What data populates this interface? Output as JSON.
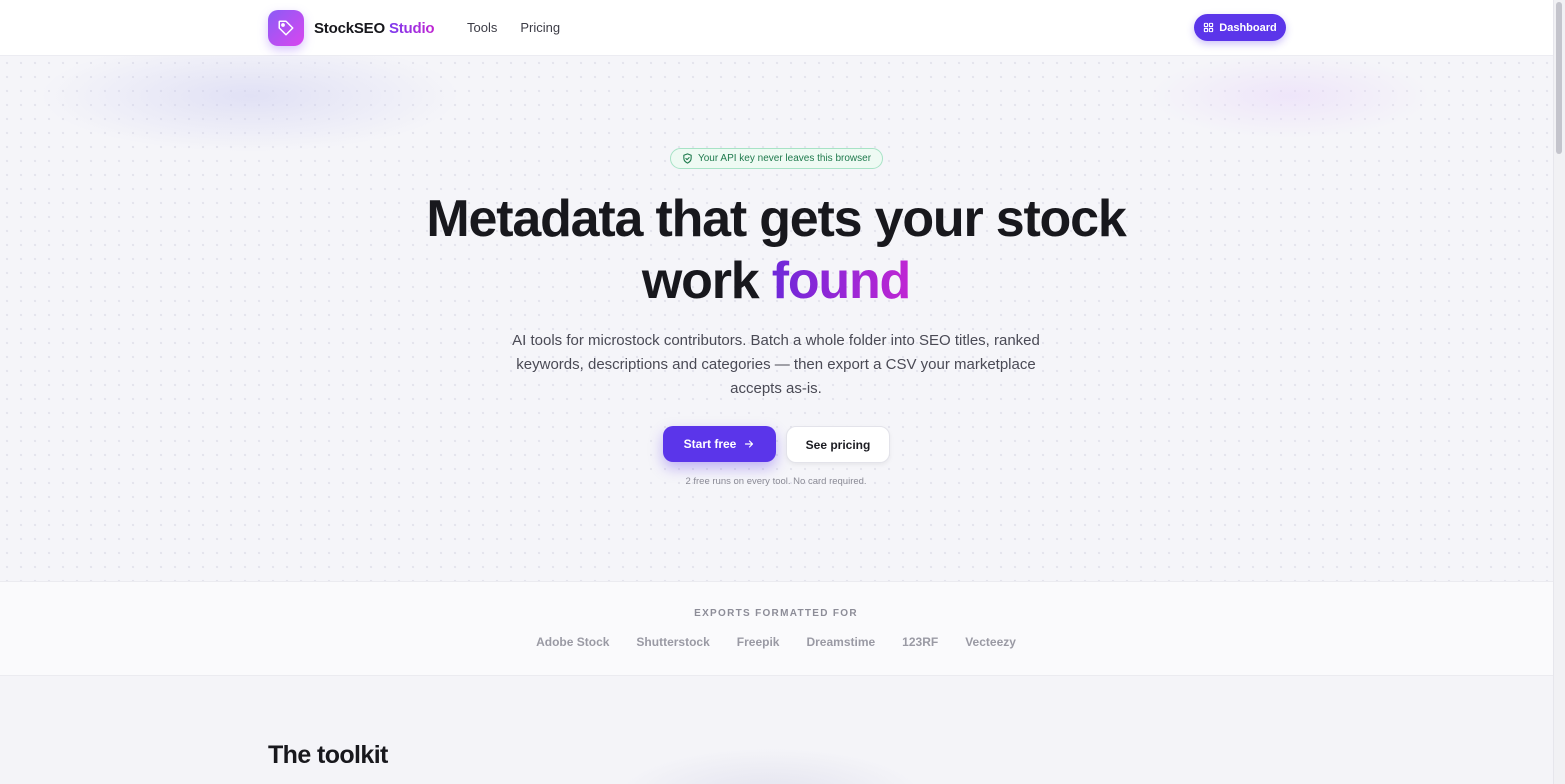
{
  "brand": {
    "name": "StockSEO",
    "accent": "Studio"
  },
  "nav": {
    "items": [
      "Tools",
      "Pricing"
    ],
    "dashboard_label": "Dashboard"
  },
  "hero": {
    "badge": "Your API key never leaves this browser",
    "title_line1": "Metadata that gets your stock",
    "title_line2_plain": "work",
    "title_line2_accent": "found",
    "subtitle": "AI tools for microstock contributors. Batch a whole folder into SEO titles, ranked keywords, descriptions and categories — then export a CSV your marketplace accepts as-is.",
    "primary_cta": "Start free",
    "secondary_cta": "See pricing",
    "note": "2 free runs on every tool. No card required."
  },
  "exports": {
    "label": "EXPORTS FORMATTED FOR",
    "marketplaces": [
      "Adobe Stock",
      "Shutterstock",
      "Freepik",
      "Dreamstime",
      "123RF",
      "Vecteezy"
    ]
  },
  "toolkit": {
    "title": "The toolkit"
  },
  "colors": {
    "primary": "#5b35ea",
    "accent_gradient_start": "#6d28d9",
    "accent_gradient_end": "#c026d3",
    "badge_green": "#1f7a4d"
  }
}
